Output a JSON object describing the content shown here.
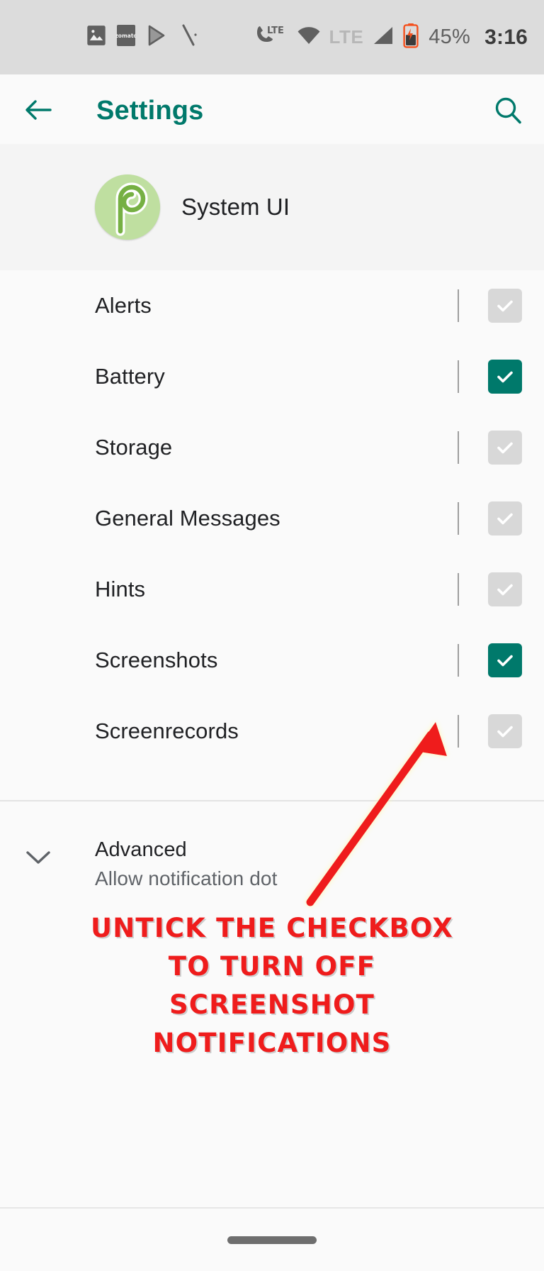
{
  "status_bar": {
    "battery_percent": "45%",
    "time": "3:16",
    "network_label": "LTE",
    "wifi_network_label": "LTE",
    "app_icons": [
      "photos-icon",
      "zomato-icon",
      "play-store-icon",
      "pen-icon"
    ],
    "zomato_label": "zomato",
    "system_icons": [
      "phone-lte-icon",
      "wifi-icon",
      "lte-label",
      "signal-bars-icon",
      "battery-charging-icon"
    ],
    "colors": {
      "background": "#dcdcdc",
      "icon": "#606060",
      "battery_accent": "#f4511e"
    }
  },
  "app_bar": {
    "title": "Settings",
    "back_icon": "back-arrow-icon",
    "search_icon": "search-icon",
    "accent_color": "#00796b"
  },
  "app_header": {
    "app_name": "System UI",
    "icon_name": "android-pie-icon",
    "icon_bg": "#bfdfa0",
    "icon_fg": "#76b043"
  },
  "channels": [
    {
      "label": "Alerts",
      "checked": false
    },
    {
      "label": "Battery",
      "checked": true
    },
    {
      "label": "Storage",
      "checked": false
    },
    {
      "label": "General Messages",
      "checked": false
    },
    {
      "label": "Hints",
      "checked": false
    },
    {
      "label": "Screenshots",
      "checked": true
    },
    {
      "label": "Screenrecords",
      "checked": false
    }
  ],
  "checkbox": {
    "checked_color": "#00796b",
    "unchecked_color": "#d8d8d8",
    "check_glyph": "checkmark-icon"
  },
  "advanced": {
    "title": "Advanced",
    "subtitle": "Allow notification dot",
    "chevron_icon": "chevron-down-icon"
  },
  "annotation": {
    "color": "#ef1c1c",
    "arrow_icon": "arrow-up-right-icon",
    "lines": [
      "UNTICK THE CHECKBOX",
      "TO TURN OFF",
      "SCREENSHOT",
      "NOTIFICATIONS"
    ]
  },
  "nav_bar": {
    "handle": "home-gesture-pill"
  }
}
